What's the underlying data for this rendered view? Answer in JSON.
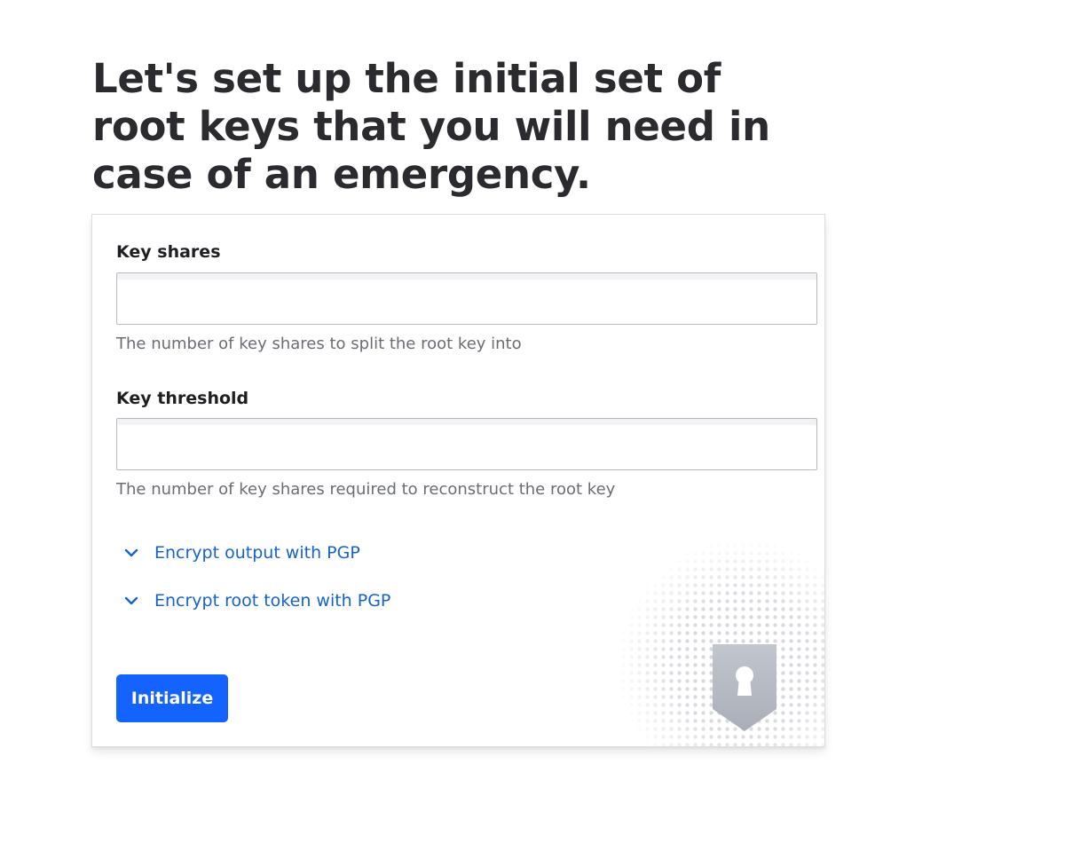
{
  "heading": "Let's set up the initial set of root keys that you will need in case of an emergency.",
  "form": {
    "key_shares": {
      "label": "Key shares",
      "value": "",
      "help": "The number of key shares to split the root key into"
    },
    "key_threshold": {
      "label": "Key threshold",
      "value": "",
      "help": "The number of key shares required to reconstruct the root key"
    },
    "toggles": [
      {
        "label": "Encrypt output with PGP",
        "icon": "chevron-down-icon"
      },
      {
        "label": "Encrypt root token with PGP",
        "icon": "chevron-down-icon"
      }
    ],
    "submit_label": "Initialize"
  },
  "decoration": {
    "icon": "shield-keyhole-icon"
  },
  "colors": {
    "accent": "#1563ff",
    "link": "#1563d2",
    "heading": "#2b2b2f",
    "help_text": "#6b6d74"
  }
}
